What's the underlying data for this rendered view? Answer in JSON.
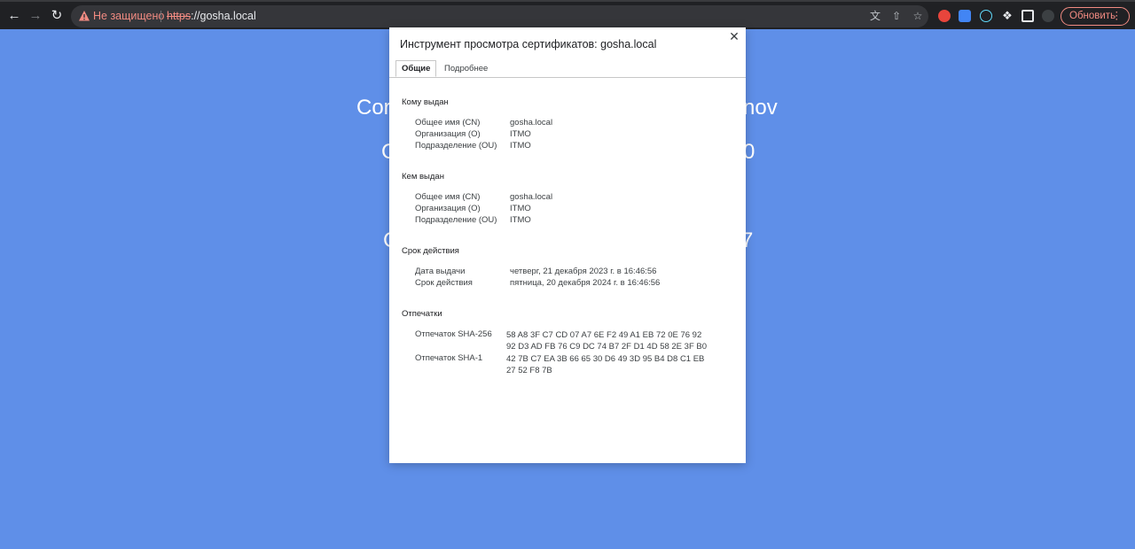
{
  "browser": {
    "security_text": "Не защищено",
    "url_scheme": "https",
    "url_rest": "://gosha.local",
    "update_label": "Обновить"
  },
  "background": {
    "line1_left": "Cor",
    "line1_right": "nov",
    "line2_left": "C",
    "line2_right": "0",
    "line3_left": "C",
    "line3_right": "7"
  },
  "dialog": {
    "title": "Инструмент просмотра сертификатов: gosha.local",
    "tabs": [
      "Общие",
      "Подробнее"
    ],
    "issued_to": {
      "title": "Кому выдан",
      "rows": [
        {
          "label": "Общее имя (CN)",
          "value": "gosha.local"
        },
        {
          "label": "Организация (O)",
          "value": "ITMO"
        },
        {
          "label": "Подразделение (OU)",
          "value": "ITMO"
        }
      ]
    },
    "issued_by": {
      "title": "Кем выдан",
      "rows": [
        {
          "label": "Общее имя (CN)",
          "value": "gosha.local"
        },
        {
          "label": "Организация (O)",
          "value": "ITMO"
        },
        {
          "label": "Подразделение (OU)",
          "value": "ITMO"
        }
      ]
    },
    "validity": {
      "title": "Срок действия",
      "rows": [
        {
          "label": "Дата выдачи",
          "value": "четверг, 21 декабря 2023 г. в 16:46:56"
        },
        {
          "label": "Срок действия",
          "value": "пятница, 20 декабря 2024 г. в 16:46:56"
        }
      ]
    },
    "fingerprints": {
      "title": "Отпечатки",
      "sha256_label": "Отпечаток SHA-256",
      "sha256_line1": "58 A8 3F C7 CD 07 A7 6E F2 49 A1 EB 72 0E 76 92",
      "sha256_line2": "92 D3 AD FB 76 C9 DC 74 B7 2F D1 4D 58 2E 3F B0",
      "sha1_label": "Отпечаток SHA-1",
      "sha1_line1": "42 7B C7 EA 3B 66 65 30 D6 49 3D 95 B4 D8 C1 EB",
      "sha1_line2": "27 52 F8 7B"
    }
  },
  "colors": {
    "page_bg": "#5f8fe8",
    "toolbar_bg": "#202124",
    "warning": "#f28b82"
  },
  "icons": [
    "back-arrow-icon",
    "forward-arrow-icon",
    "reload-icon",
    "warning-icon",
    "translate-icon",
    "share-icon",
    "star-icon",
    "extension-icon",
    "puzzle-icon",
    "sidepanel-icon",
    "profile-icon",
    "close-icon"
  ]
}
